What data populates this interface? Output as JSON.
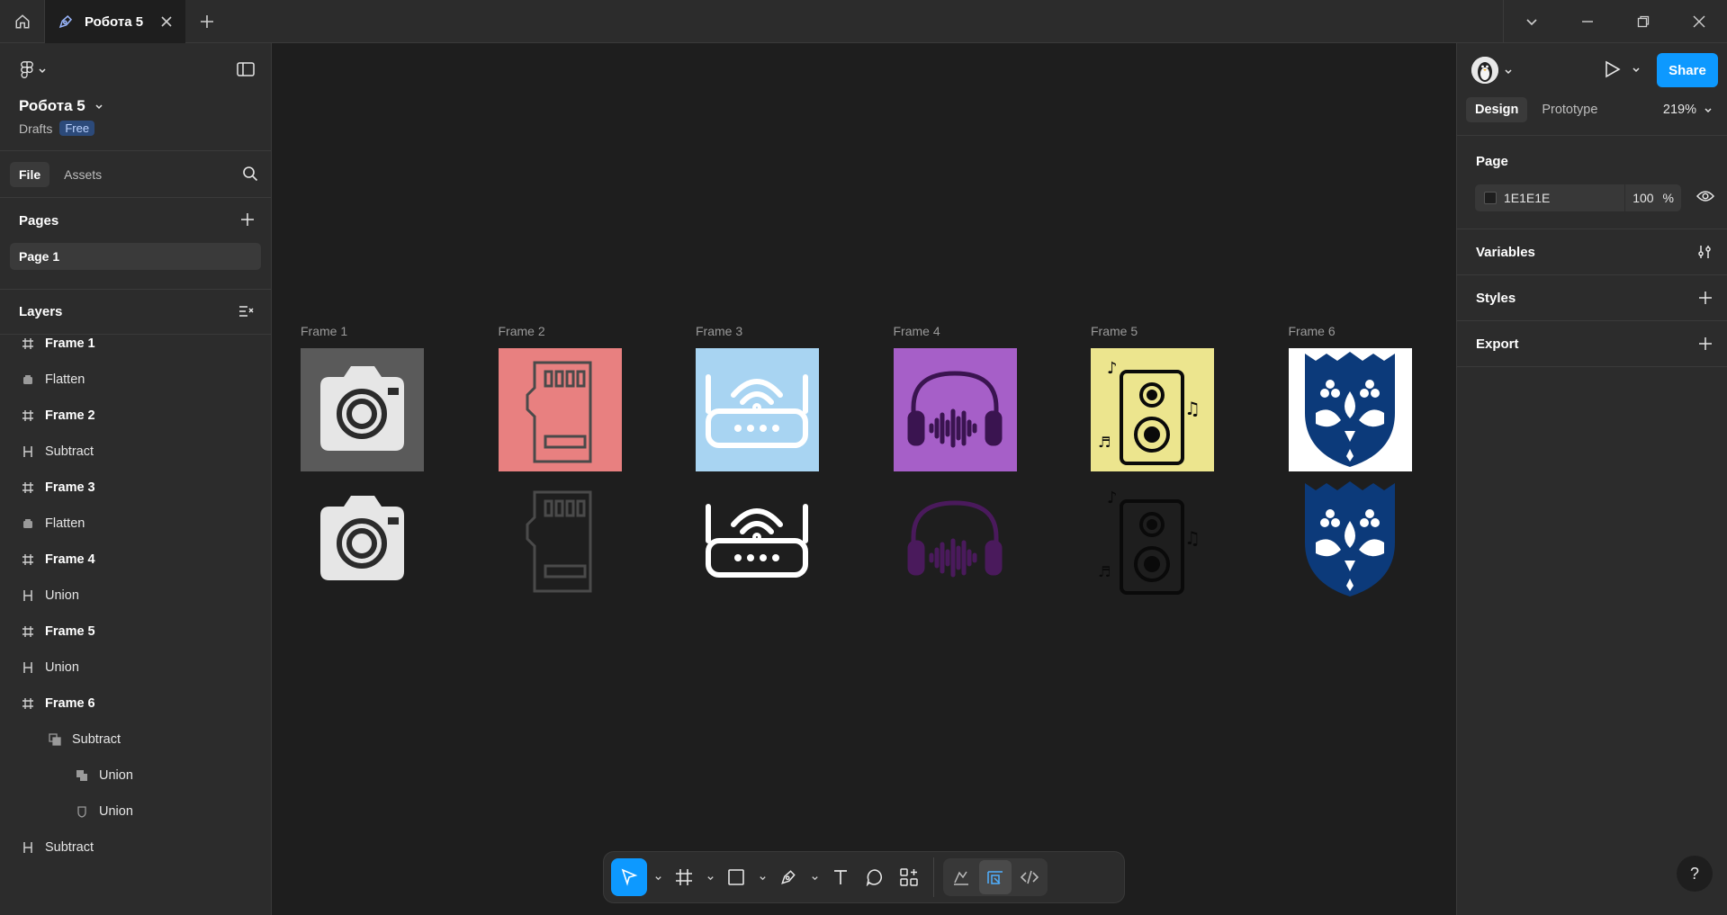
{
  "titlebar": {
    "tab_title": "Робота 5"
  },
  "left_panel": {
    "file_name": "Робота 5",
    "location": "Drafts",
    "plan_badge": "Free",
    "tabs": [
      "File",
      "Assets"
    ],
    "pages_title": "Pages",
    "pages": [
      "Page 1"
    ],
    "layers_title": "Layers",
    "layers": [
      {
        "name": "Frame 1",
        "icon": "frame-icon",
        "indent": 0,
        "bold": true
      },
      {
        "name": "Flatten",
        "icon": "flatten-icon",
        "indent": 0,
        "bold": false
      },
      {
        "name": "Frame 2",
        "icon": "frame-icon",
        "indent": 0,
        "bold": true
      },
      {
        "name": "Subtract",
        "icon": "boolean-icon",
        "indent": 0,
        "bold": false
      },
      {
        "name": "Frame 3",
        "icon": "frame-icon",
        "indent": 0,
        "bold": true
      },
      {
        "name": "Flatten",
        "icon": "flatten-icon",
        "indent": 0,
        "bold": false
      },
      {
        "name": "Frame 4",
        "icon": "frame-icon",
        "indent": 0,
        "bold": true
      },
      {
        "name": "Union",
        "icon": "boolean-icon",
        "indent": 0,
        "bold": false
      },
      {
        "name": "Frame 5",
        "icon": "frame-icon",
        "indent": 0,
        "bold": true
      },
      {
        "name": "Union",
        "icon": "boolean-icon",
        "indent": 0,
        "bold": false
      },
      {
        "name": "Frame 6",
        "icon": "frame-icon",
        "indent": 0,
        "bold": true
      },
      {
        "name": "Subtract",
        "icon": "subtract-icon",
        "indent": 1,
        "bold": false
      },
      {
        "name": "Union",
        "icon": "union-icon",
        "indent": 2,
        "bold": false
      },
      {
        "name": "Union",
        "icon": "shield-icon",
        "indent": 2,
        "bold": false
      },
      {
        "name": "Subtract",
        "icon": "boolean-icon",
        "indent": 0,
        "bold": false
      }
    ]
  },
  "canvas": {
    "frames": [
      {
        "label": "Frame 1",
        "bg": "#5a5a5a",
        "icon": "camera-icon"
      },
      {
        "label": "Frame 2",
        "bg": "#e88080",
        "icon": "sd-card-icon"
      },
      {
        "label": "Frame 3",
        "bg": "#a8d4f2",
        "icon": "router-icon"
      },
      {
        "label": "Frame 4",
        "bg": "#a65fc8",
        "icon": "headphones-icon"
      },
      {
        "label": "Frame 5",
        "bg": "#ece58e",
        "icon": "speaker-icon"
      },
      {
        "label": "Frame 6",
        "bg": "#ffffff",
        "icon": "ornament-shield-icon"
      }
    ]
  },
  "toolbar": {
    "tools": [
      "move-tool-icon",
      "frame-tool-icon",
      "rectangle-tool-icon",
      "pen-tool-icon",
      "text-tool-icon",
      "comment-tool-icon",
      "actions-tool-icon"
    ]
  },
  "right_panel": {
    "share_label": "Share",
    "tabs": [
      "Design",
      "Prototype"
    ],
    "zoom": "219%",
    "page_title": "Page",
    "bg_hex": "1E1E1E",
    "bg_opacity": "100",
    "opacity_unit": "%",
    "sections": [
      "Variables",
      "Styles",
      "Export"
    ],
    "help": "?"
  },
  "colors": {
    "accent": "#0d99ff",
    "panel": "#2c2c2c",
    "canvas": "#1e1e1e"
  }
}
